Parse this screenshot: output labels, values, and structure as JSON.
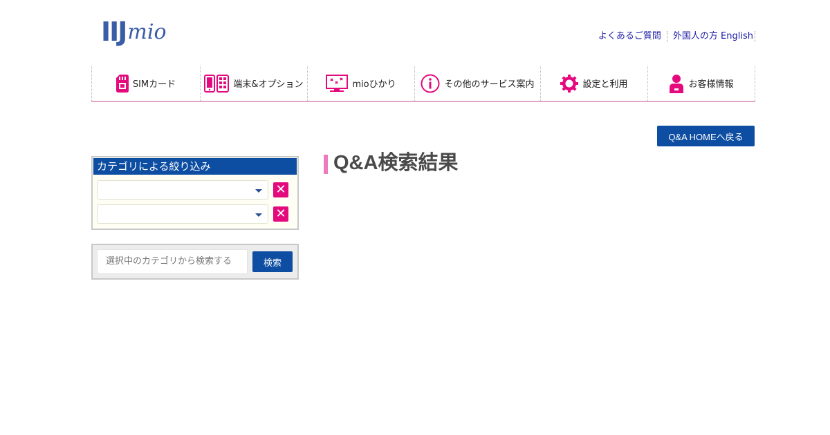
{
  "header": {
    "logo_bold": "IIJ",
    "logo_light": "mio",
    "links": [
      {
        "label": "よくあるご質問"
      },
      {
        "label": "外国人の方 English"
      }
    ]
  },
  "nav": {
    "items": [
      {
        "label": "SIMカード",
        "icon": "sim-card-icon"
      },
      {
        "label": "端末&オプション",
        "icon": "devices-icon"
      },
      {
        "label": "mioひかり",
        "icon": "monitor-icon"
      },
      {
        "label": "その他のサービス案内",
        "icon": "info-icon"
      },
      {
        "label": "設定と利用",
        "icon": "gear-icon"
      },
      {
        "label": "お客様情報",
        "icon": "user-icon"
      }
    ],
    "accent_color": "#e4097d"
  },
  "back_button": {
    "label": "Q&A HOMEへ戻る"
  },
  "category_filter": {
    "title": "カテゴリによる絞り込み",
    "selects": [
      {
        "value": ""
      },
      {
        "value": ""
      }
    ],
    "clear_label": "✕"
  },
  "search": {
    "placeholder": "選択中のカテゴリから検索する",
    "button_label": "検索"
  },
  "page_title": "Q&A検索結果",
  "colors": {
    "primary": "#0e4ea2",
    "accent": "#e4097d",
    "title_bar": "#ee7bbd"
  }
}
